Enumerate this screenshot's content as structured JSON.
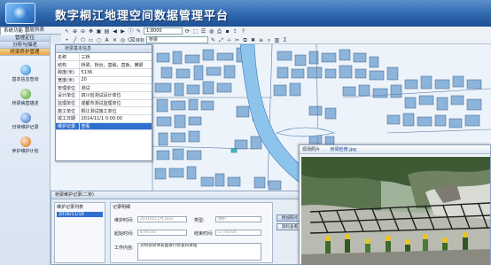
{
  "app": {
    "title": "数字桐江地理空间数据管理平台"
  },
  "menu": {
    "tabs": [
      "系统功能",
      "图层列表"
    ]
  },
  "sidebar": {
    "groups": [
      "管理定位",
      "分析与描述",
      "桥梁养护管理"
    ],
    "active_group_index": 2,
    "items": [
      {
        "label": "基本信息查询",
        "icon": "info-icon"
      },
      {
        "label": "桥梁病害描述",
        "icon": "bridge-icon"
      },
      {
        "label": "日常维护记录",
        "icon": "record-icon"
      },
      {
        "label": "养护维护计划",
        "icon": "plan-icon"
      }
    ]
  },
  "toolbar": {
    "scale_value": "1:8000",
    "layer_label": "目标",
    "layer_value": "桥梁"
  },
  "attr_panel": {
    "title": "桥梁基本信息",
    "rows": [
      {
        "key": "名称",
        "value": "三桥"
      },
      {
        "key": "结构",
        "value": "桥梁，桥台，基础，直板，横梁"
      },
      {
        "key": "跨度(米)",
        "value": "5136"
      },
      {
        "key": "宽度(米)",
        "value": "20"
      },
      {
        "key": "管理单位",
        "value": "测试"
      },
      {
        "key": "设计单位",
        "value": "四川省测试设计单位"
      },
      {
        "key": "监理单位",
        "value": "成都市测试监理单位"
      },
      {
        "key": "施工单位",
        "value": "桐江测试施工单位"
      },
      {
        "key": "竣工日期",
        "value": "2014/11/1 0:00:00"
      },
      {
        "key": "维护记录",
        "value": "查看"
      }
    ],
    "selected_row_index": 9
  },
  "maintenance": {
    "title": "桥梁维护记录(二桥)",
    "list_title": "维护记录列表",
    "list_items": [
      "2016/11/16"
    ],
    "detail_title": "记录明细",
    "labels": {
      "record_time": "维护时间:",
      "type": "类型:",
      "start_time": "起始时间:",
      "end_time": "结束时间:",
      "content": "工作内容:"
    },
    "values": {
      "record_time": "2016年11月16日",
      "type": "维护",
      "start_time": "8:00:00",
      "end_time": "17:00:00",
      "content": "对桥梁梁体表面进行修复和清理"
    },
    "side_buttons": [
      "附加照片",
      "资料查看"
    ]
  },
  "photo_viewer": {
    "tabs": [
      "现场照片",
      "桥梁检修.jpg"
    ]
  }
}
